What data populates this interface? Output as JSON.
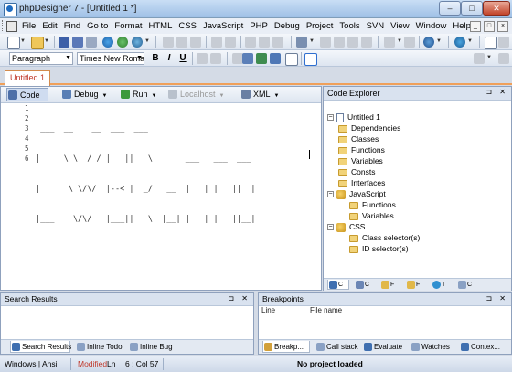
{
  "window": {
    "title": "phpDesigner 7 - [Untitled 1 *]",
    "min": "‒",
    "max": "□",
    "close": "✕"
  },
  "menu": [
    "File",
    "Edit",
    "Find",
    "Go to",
    "Format",
    "HTML",
    "CSS",
    "JavaScript",
    "PHP",
    "Debug",
    "Project",
    "Tools",
    "SVN",
    "View",
    "Window",
    "Help"
  ],
  "mdi_controls": [
    "_",
    "□",
    "×"
  ],
  "format_bar": {
    "style_combo": "Paragraph",
    "font_combo": "Times New Roma",
    "bold": "B",
    "italic": "I",
    "underline": "U"
  },
  "document_tab": "Untitled 1",
  "editor_toolbar": {
    "code": "Code",
    "debug": "Debug",
    "run": "Run",
    "localhost": "Localhost",
    "xml": "XML"
  },
  "line_numbers": [
    "1",
    "2",
    "3",
    "4",
    "5",
    "6"
  ],
  "code_lines": [
    " ___  __    __  ___  ___",
    "|     \\ \\  / / |   ||   \\       ___   ___  ___",
    "|      \\ \\/\\/  |--< |  _/   __  |   | |   ||  |",
    "|___    \\/\\/   |___||   \\  |__| |   | |   ||__|",
    "",
    ""
  ],
  "code_explorer": {
    "title": "Code Explorer",
    "pane_buttons": "⊐ ✕",
    "root": "Untitled 1",
    "items": [
      "Dependencies",
      "Classes",
      "Functions",
      "Variables",
      "Consts",
      "Interfaces"
    ],
    "javascript": {
      "label": "JavaScript",
      "children": [
        "Functions",
        "Variables"
      ]
    },
    "css": {
      "label": "CSS",
      "children": [
        "Class selector(s)",
        "ID selector(s)"
      ]
    },
    "tabs": [
      "C",
      "C",
      "F",
      "F",
      "T",
      "C"
    ]
  },
  "search_pane": {
    "title": "Search Results",
    "pane_buttons": "⊐ ✕",
    "tabs": [
      "Search Results",
      "Inline Todo",
      "Inline Bug"
    ]
  },
  "breakpoints_pane": {
    "title": "Breakpoints",
    "pane_buttons": "⊐ ✕",
    "columns": [
      "Line",
      "File name"
    ],
    "tabs": [
      "Breakp...",
      "Call stack",
      "Evaluate",
      "Watches",
      "Contex..."
    ]
  },
  "status": {
    "encoding": "Windows | Ansi",
    "modified": "Modified",
    "ln": "Ln",
    "position": "6 : Col 57",
    "project": "No project loaded"
  },
  "colors": {
    "modified": "#c0392b",
    "accent_tab": "#f0a05a"
  }
}
